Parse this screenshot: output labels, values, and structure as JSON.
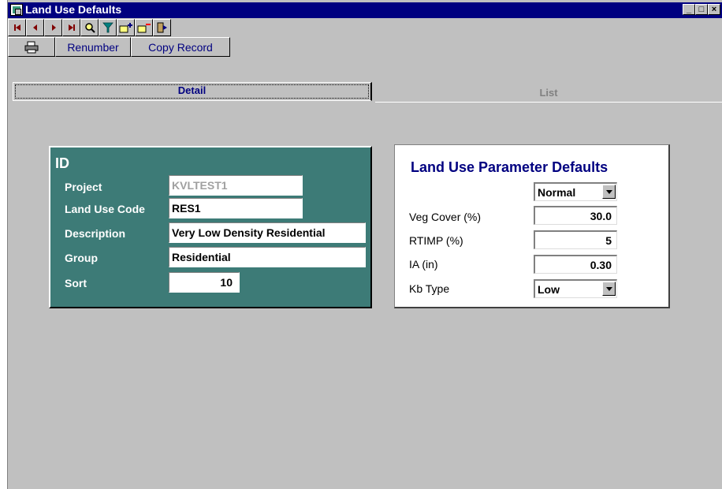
{
  "window": {
    "title": "Land Use Defaults",
    "controls": {
      "minimize": "_",
      "maximize": "□",
      "close": "×"
    }
  },
  "toolbar": {
    "icons": [
      "first-record-icon",
      "prev-record-icon",
      "next-record-icon",
      "last-record-icon",
      "find-icon",
      "filter-icon",
      "add-record-icon",
      "delete-record-icon",
      "exit-icon"
    ]
  },
  "actions": {
    "renumber_label": "Renumber",
    "copy_record_label": "Copy Record"
  },
  "tabs": {
    "detail": "Detail",
    "list": "List"
  },
  "id_panel": {
    "title": "ID",
    "project_label": "Project",
    "project_value": "KVLTEST1",
    "land_use_code_label": "Land Use Code",
    "land_use_code_value": "RES1",
    "description_label": "Description",
    "description_value": "Very Low Density Residential",
    "group_label": "Group",
    "group_value": "Residential",
    "sort_label": "Sort",
    "sort_value": "10"
  },
  "param_panel": {
    "title": "Land Use Parameter Defaults",
    "mode_value": "Normal",
    "veg_cover_label": "Veg Cover (%)",
    "veg_cover_value": "30.0",
    "rtimp_label": "RTIMP (%)",
    "rtimp_value": "5",
    "ia_label": "IA (in)",
    "ia_value": "0.30",
    "kb_type_label": "Kb Type",
    "kb_type_value": "Low"
  },
  "colors": {
    "title_bar": "#000080",
    "id_panel_bg": "#3d7b77",
    "window_bg": "#c0c0c0",
    "accent_text": "#000080"
  }
}
